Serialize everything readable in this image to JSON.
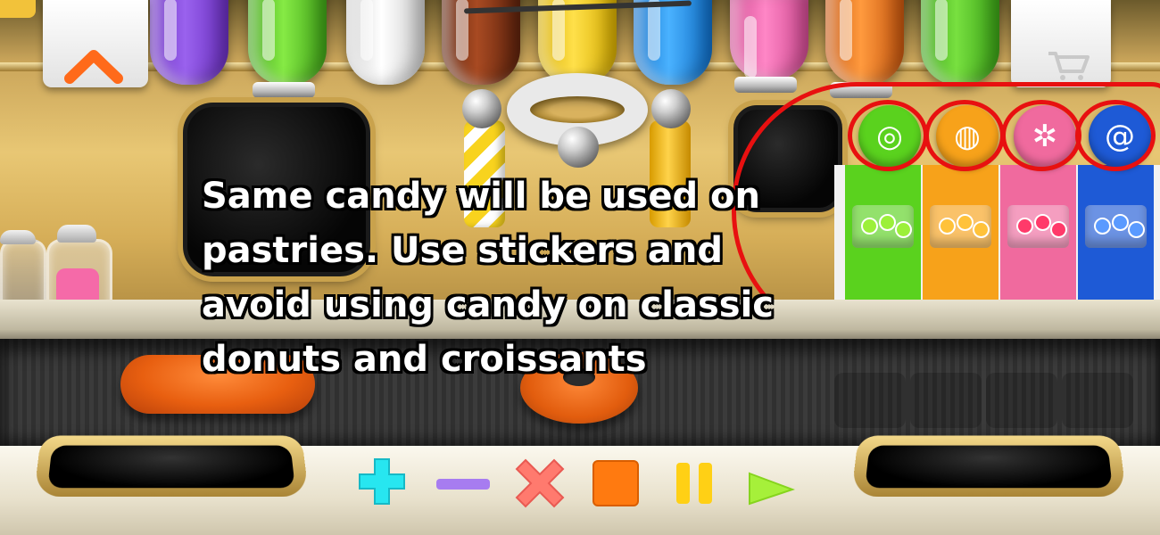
{
  "overlay": {
    "message": "Same candy will be used on pastries. Use stickers and avoid using candy on classic donuts and croissants"
  },
  "icons": {
    "up_arrow": "chevron-up-icon",
    "shop": "shopping-cart-icon",
    "add": "plus-icon",
    "subtract": "minus-icon",
    "multiply": "x-icon",
    "stop": "stop-icon",
    "pause": "pause-icon",
    "play": "play-icon"
  },
  "colors": {
    "up_arrow": "#ff6a1a",
    "plus": "#27e6f0",
    "minus": "#a77cf0",
    "x": "#ff7a6e",
    "stop": "#ff7a10",
    "pause": "#ffd015",
    "play": "#a6f03a",
    "annotation": "#e81010"
  },
  "dispensers": [
    "#8a4de0",
    "#6fd62b",
    "#f2f2f2",
    "#8b3a1a",
    "#f7d21a",
    "#2a9df0",
    "#f06ab0",
    "#f07a20",
    "#58cf24"
  ],
  "candy_flavors": [
    {
      "icon": "lime-slice-icon",
      "color": "#5ad21e"
    },
    {
      "icon": "orange-slice-icon",
      "color": "#f7a21a"
    },
    {
      "icon": "peppermint-icon",
      "color": "#f06a9e"
    },
    {
      "icon": "blue-swirl-icon",
      "color": "#1e5ad6"
    }
  ]
}
